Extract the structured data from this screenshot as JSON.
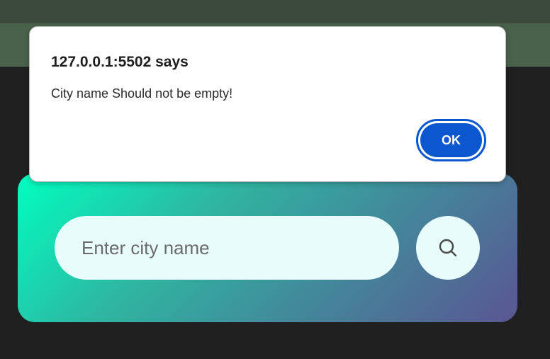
{
  "browser": {
    "dialog": {
      "title": "127.0.0.1:5502 says",
      "message": "City name Should not be empty!",
      "ok_label": "OK",
      "accent_color": "#0b57d0"
    }
  },
  "weather_app": {
    "search": {
      "placeholder": "Enter city name",
      "value": "",
      "button_icon": "search-icon"
    },
    "card_gradient": [
      "#00ffc0",
      "#5a5592"
    ]
  }
}
